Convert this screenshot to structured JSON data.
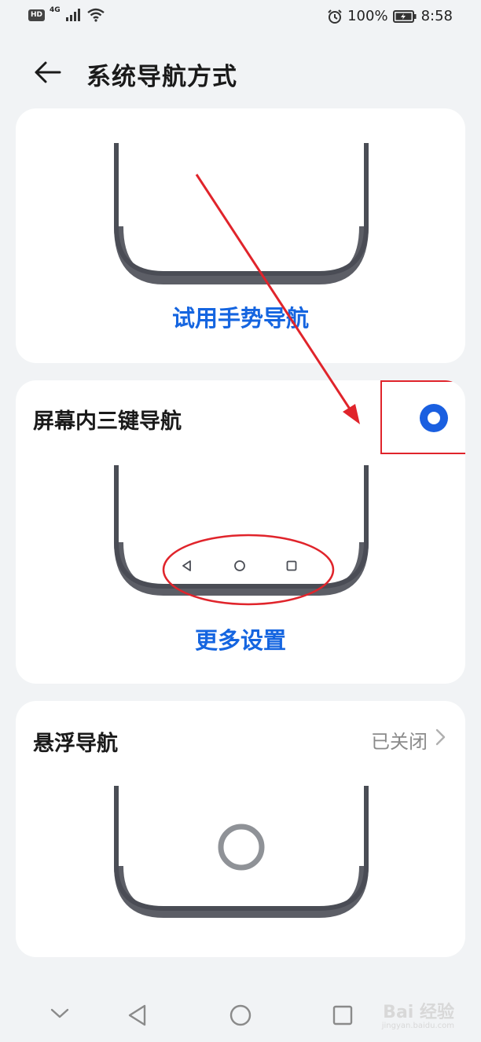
{
  "status_bar": {
    "left_badges": [
      "HD",
      "4G"
    ],
    "battery_percent": "100%",
    "time": "8:58",
    "icons": [
      "signal-icon",
      "wifi-icon",
      "alarm-icon",
      "battery-charging-icon"
    ]
  },
  "header": {
    "title": "系统导航方式",
    "back_icon": "arrow-left-icon"
  },
  "cards": {
    "gesture": {
      "link_label": "试用手势导航"
    },
    "three_key": {
      "title": "屏幕内三键导航",
      "selected": true,
      "link_label": "更多设置",
      "nav_icons": [
        "back-triangle-icon",
        "home-circle-icon",
        "recent-square-icon"
      ]
    },
    "floating": {
      "title": "悬浮导航",
      "status": "已关闭"
    }
  },
  "system_nav": {
    "icons": [
      "collapse-chevron-icon",
      "back-icon",
      "home-icon",
      "recents-icon"
    ]
  },
  "watermark": {
    "text": "Bai 经验",
    "sub": "jingyan.baidu.com"
  },
  "colors": {
    "accent_blue": "#1565e0",
    "annotation_red": "#e0242b",
    "phone_frame": "#4a4d55",
    "background": "#f1f3f5"
  }
}
